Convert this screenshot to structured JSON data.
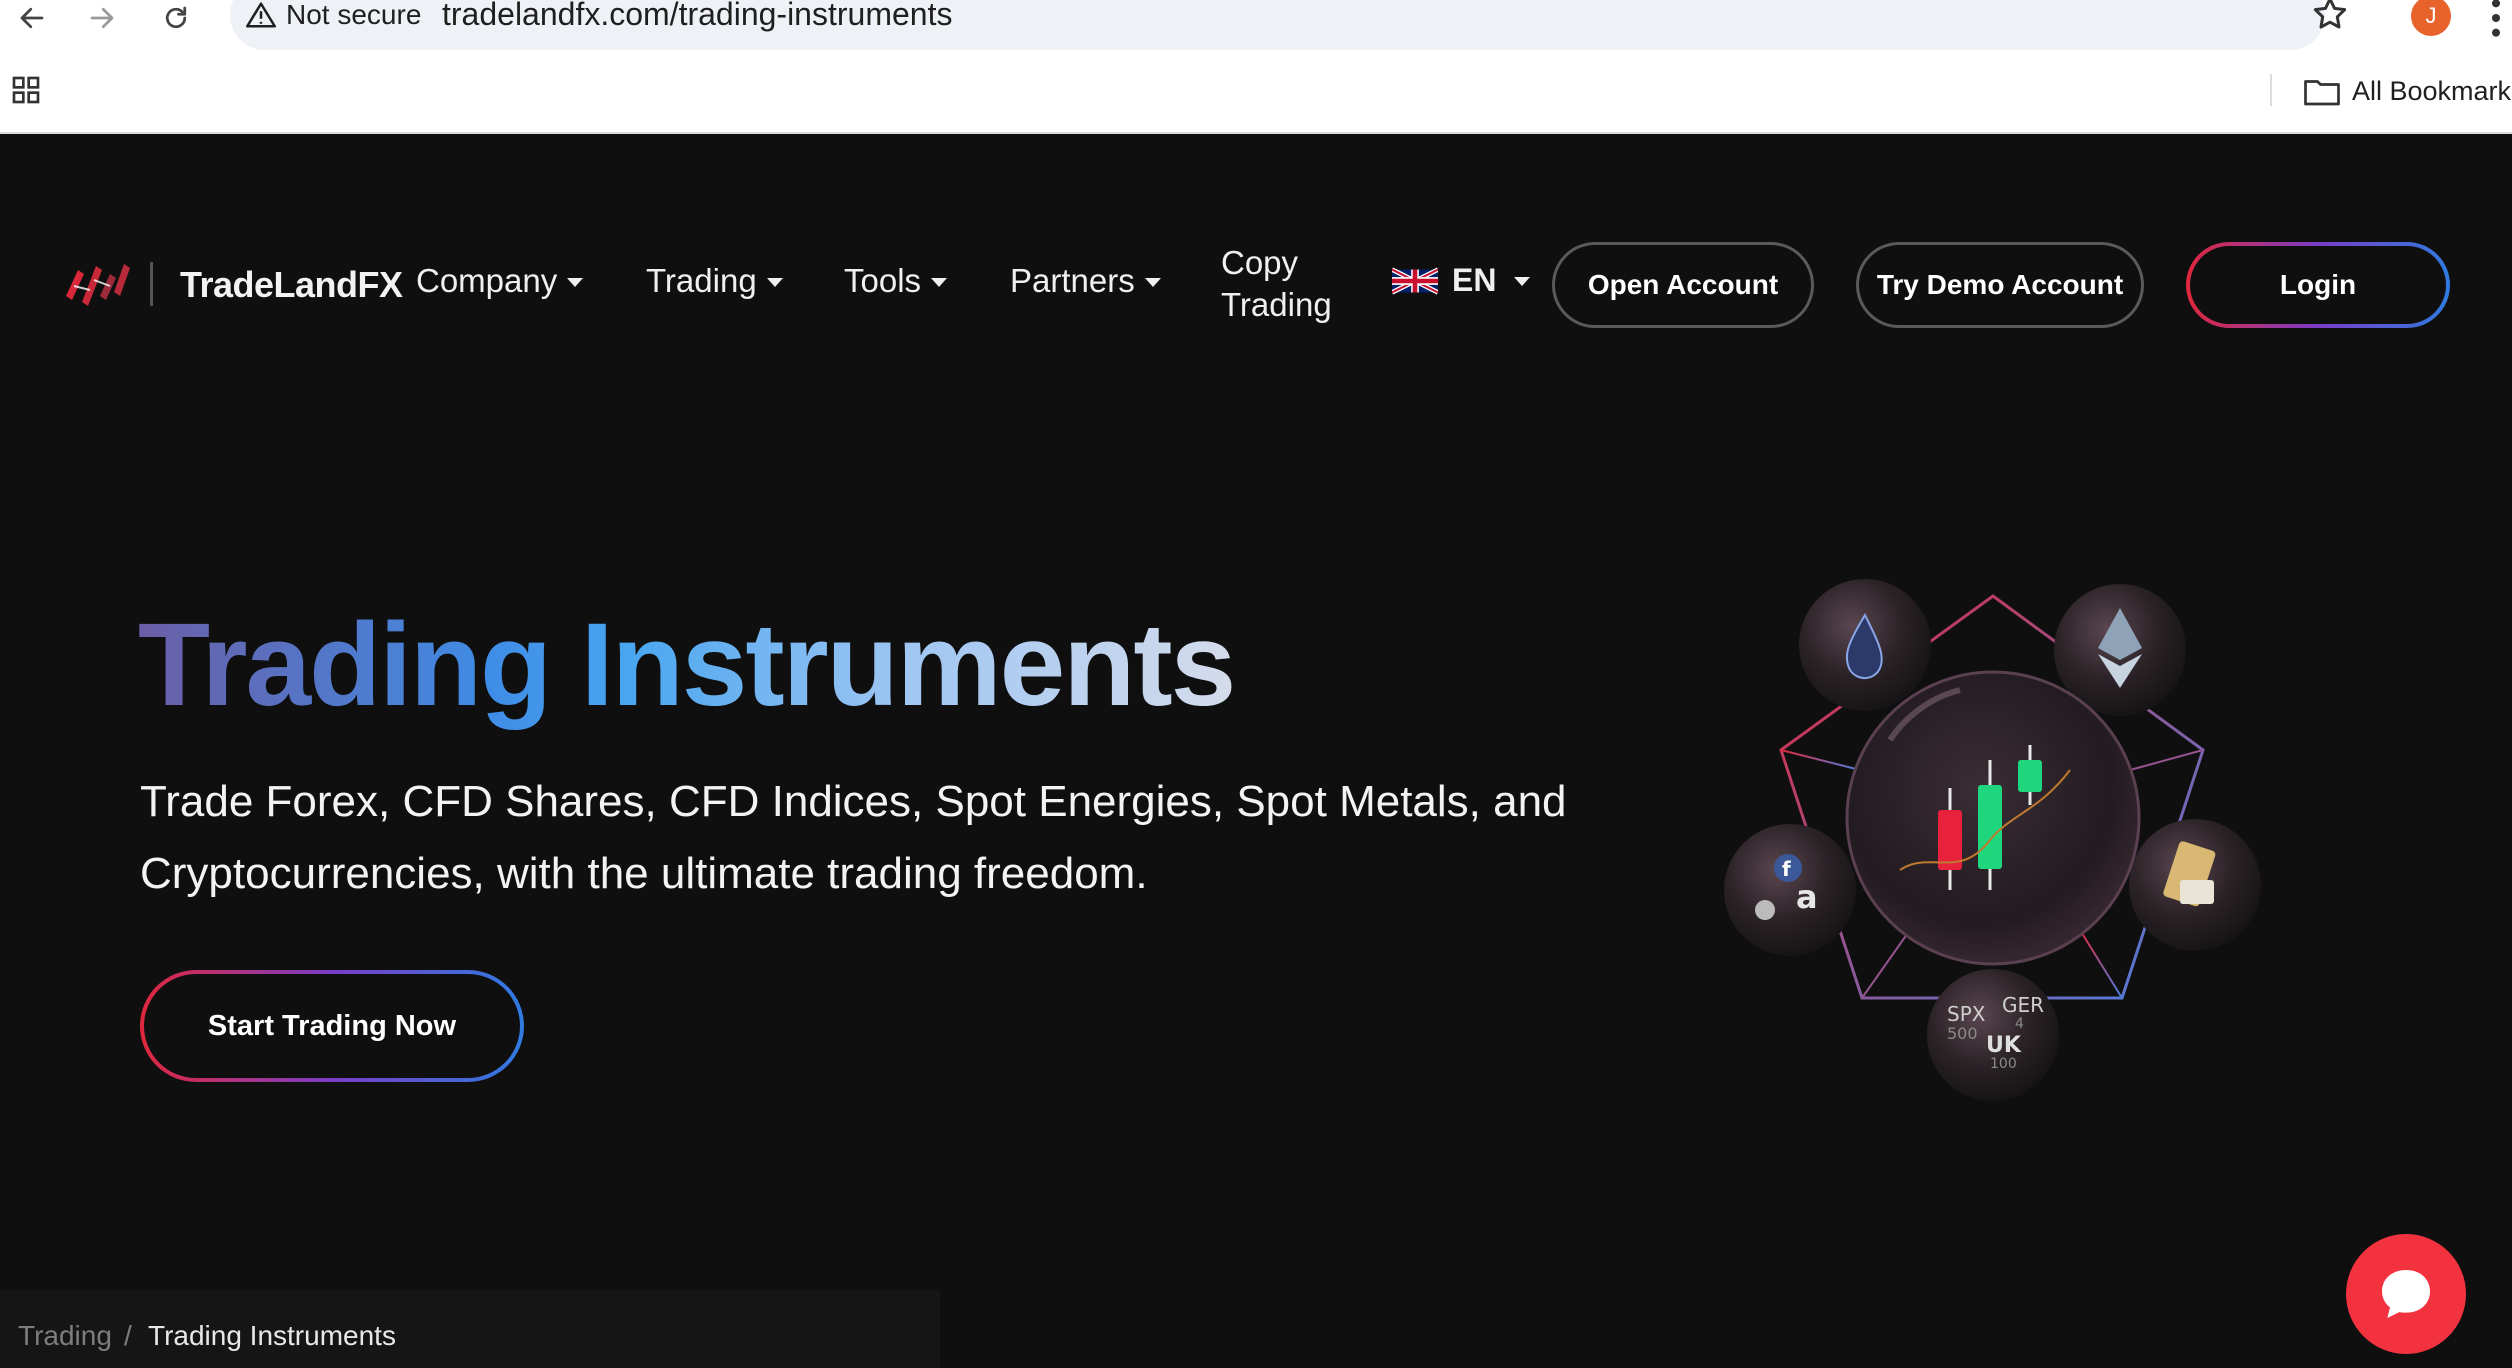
{
  "browser": {
    "security_label": "Not secure",
    "url": "tradelandfx.com/trading-instruments",
    "profile_initial": "J",
    "bookmarks_label": "All Bookmarks"
  },
  "site": {
    "brand": "TradeLandFX",
    "menu": [
      {
        "label": "Company"
      },
      {
        "label": "Trading"
      },
      {
        "label": "Tools"
      },
      {
        "label": "Partners"
      }
    ],
    "copy_trading_line1": "Copy",
    "copy_trading_line2": "Trading",
    "language": "EN",
    "open_account": "Open Account",
    "demo_account": "Try Demo Account",
    "login": "Login"
  },
  "hero": {
    "title": "Trading Instruments",
    "subtitle": "Trade Forex, CFD Shares, CFD Indices, Spot Energies, Spot Metals, and Cryptocurrencies, with the ultimate trading freedom.",
    "cta": "Start Trading Now",
    "art_texts": {
      "spx": "SPX",
      "spx_sub": "500",
      "ger": "GER",
      "ger_sub": "4",
      "uk": "UK",
      "uk_sub": "100",
      "amazon": "a"
    }
  },
  "breadcrumb": {
    "parent": "Trading",
    "separator": "/",
    "current": "Trading Instruments"
  },
  "colors": {
    "background": "#0f0f10",
    "accent_red": "#e0283c",
    "accent_blue": "#2f7be0",
    "chat": "#f2333f"
  }
}
